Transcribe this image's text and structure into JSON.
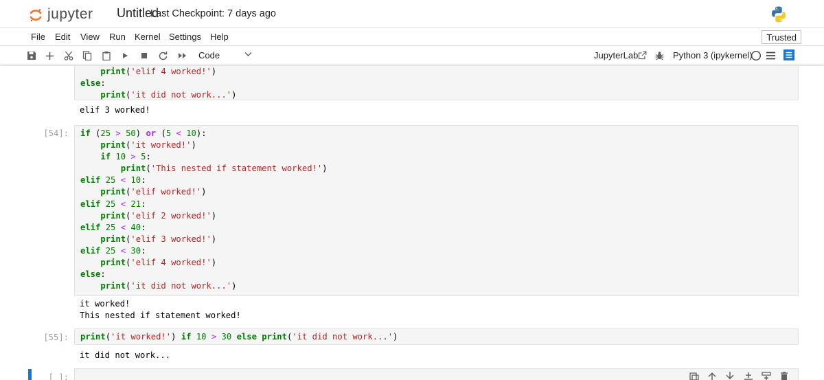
{
  "header": {
    "logo_text": "jupyter",
    "doc_title": "Untitled",
    "checkpoint": "Last Checkpoint: 7 days ago"
  },
  "menu": {
    "items": [
      "File",
      "Edit",
      "View",
      "Run",
      "Kernel",
      "Settings",
      "Help"
    ],
    "trusted": "Trusted"
  },
  "toolbar": {
    "cell_type": "Code",
    "jupyterlab_link": "JupyterLab",
    "kernel": "Python 3 (ipykernel)",
    "icons": [
      "save-icon",
      "add-cell-icon",
      "cut-icon",
      "copy-icon",
      "paste-icon",
      "run-icon",
      "stop-icon",
      "restart-icon",
      "run-all-icon",
      "chevron-down-icon",
      "external-link-icon",
      "bug-icon",
      "kernel-idle-icon",
      "menu-icon",
      "property-inspector-icon"
    ]
  },
  "cells": {
    "c53": {
      "code_tail": [
        "    print('elif 4 worked!')",
        "else:",
        "    print('it did not work...')"
      ],
      "output": "elif 3 worked!"
    },
    "c54": {
      "prompt": "[54]:",
      "output": [
        "it worked!",
        "This nested if statement worked!"
      ]
    },
    "c55": {
      "prompt": "[55]:",
      "output": "it did not work..."
    },
    "c56": {
      "prompt": "[ ]:"
    }
  },
  "colors": {
    "keyword": "#008000",
    "string": "#ba2121",
    "operator": "#aa22ff",
    "active_cell": "#1976d2",
    "cell_bg": "#f5f5f5"
  }
}
